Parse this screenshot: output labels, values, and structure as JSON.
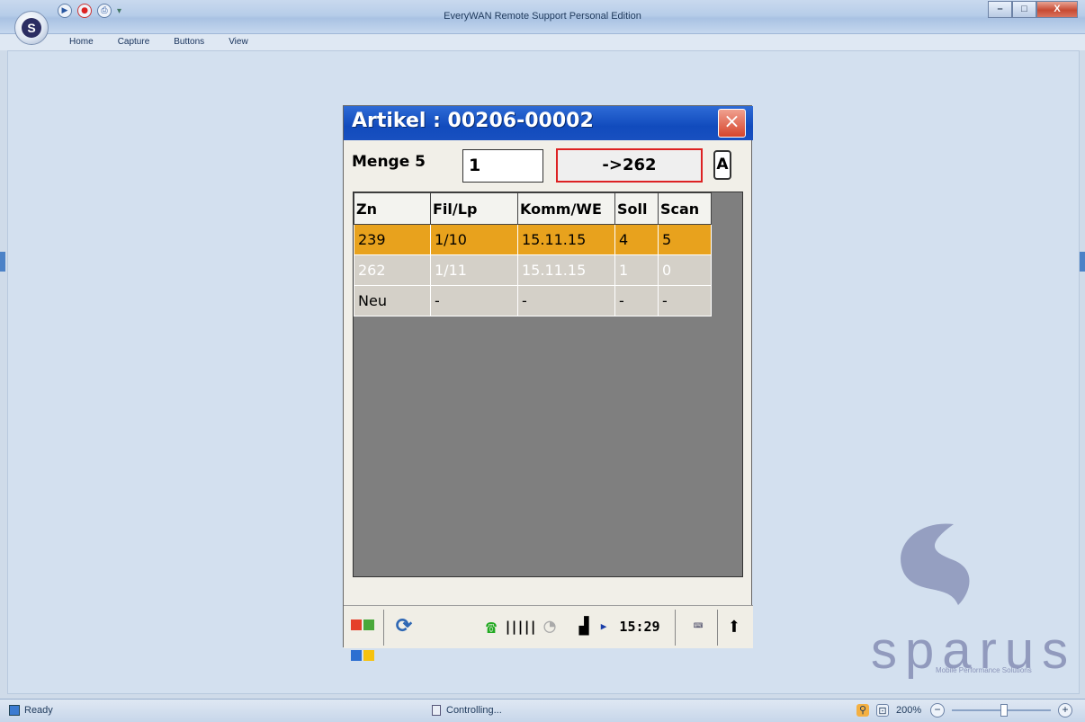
{
  "window": {
    "title": "EveryWAN Remote Support Personal Edition",
    "controls": {
      "minimize": "–",
      "maximize": "□",
      "close": "X"
    }
  },
  "quick_access": {
    "play": "▶",
    "stop": "●",
    "print": "⎙",
    "dropdown": "▾"
  },
  "menu": [
    "Home",
    "Capture",
    "Buttons",
    "View"
  ],
  "device": {
    "title": "Artikel : 00206-00002",
    "close": "×",
    "menge_label": "Menge 5",
    "qty_value": "1",
    "goto_button": "->262",
    "a_button": "A",
    "table": {
      "headers": [
        "Zn",
        "Fil/Lp",
        "Komm/WE",
        "Soll",
        "Scan"
      ],
      "rows": [
        [
          "239",
          "1/10",
          "15.11.15",
          "4",
          "5"
        ],
        [
          "262",
          "1/11",
          "15.11.15",
          "1",
          "0"
        ],
        [
          "Neu",
          "-",
          "-",
          "-",
          "-"
        ]
      ],
      "selected_row": 0
    },
    "taskbar": {
      "clock": "15:29",
      "icons": [
        "windows-start-icon",
        "sync-icon",
        "phone-icon",
        "barcode-icon",
        "battery-icon",
        "signal-icon",
        "keyboard-icon",
        "up-arrow-icon"
      ]
    }
  },
  "watermark": {
    "brand": "sparus",
    "tagline": "Mobile Performance Solutions"
  },
  "status": {
    "left": "Ready",
    "center": "Controlling...",
    "zoom": "200%",
    "zoom_in": "+",
    "zoom_out": "−"
  },
  "colors": {
    "device_titlebar": "#114bbd",
    "selected_row": "#e8a21d",
    "grid_background": "#7f7f7f",
    "goto_border": "#dd2222",
    "workspace": "#d3e0ef"
  }
}
